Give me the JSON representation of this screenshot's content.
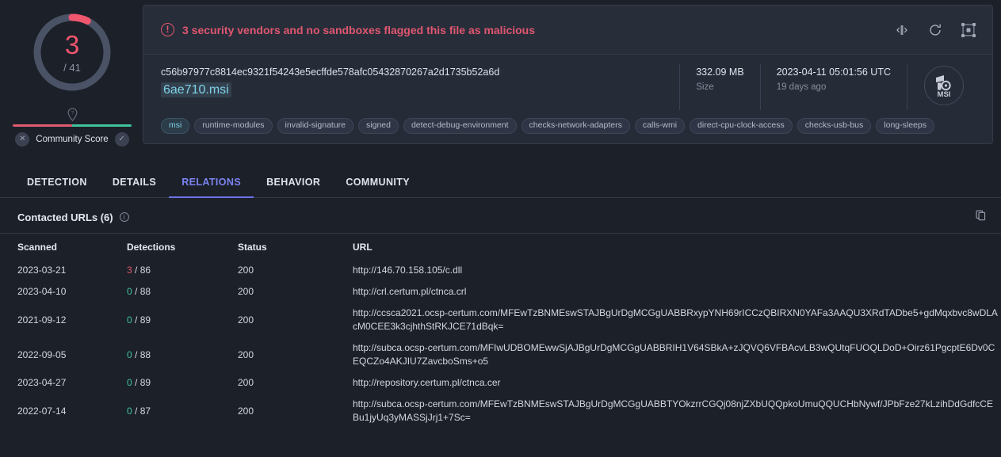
{
  "score": {
    "detections": "3",
    "total": "/ 41",
    "ring_color": "#f0566e",
    "community_label": "Community Score",
    "negative_icon": "x-circle-icon",
    "positive_icon": "check-circle-icon",
    "pin_icon": "help-pin-icon"
  },
  "alert": {
    "text": "3 security vendors and no sandboxes flagged this file as malicious",
    "color": "#e0576f",
    "icon": "exclamation-circle-icon"
  },
  "header_actions": [
    {
      "name": "similar-files-icon",
      "label": "Similar files"
    },
    {
      "name": "reanalyze-icon",
      "label": "Reanalyze"
    },
    {
      "name": "graph-icon",
      "label": "Graph"
    }
  ],
  "file": {
    "hash": "c56b97977c8814ec9321f54243e5ecffde578afc05432870267a2d1735b52a6d",
    "filename": "6ae710.msi",
    "size_value": "332.09 MB",
    "size_label": "Size",
    "date_value": "2023-04-11 05:01:56 UTC",
    "date_label": "19 days ago",
    "type_label": "MSI",
    "type_icon": "msi-installer-icon"
  },
  "tags": [
    {
      "label": "msi",
      "primary": true
    },
    {
      "label": "runtime-modules",
      "primary": false
    },
    {
      "label": "invalid-signature",
      "primary": false
    },
    {
      "label": "signed",
      "primary": false
    },
    {
      "label": "detect-debug-environment",
      "primary": false
    },
    {
      "label": "checks-network-adapters",
      "primary": false
    },
    {
      "label": "calls-wmi",
      "primary": false
    },
    {
      "label": "direct-cpu-clock-access",
      "primary": false
    },
    {
      "label": "checks-usb-bus",
      "primary": false
    },
    {
      "label": "long-sleeps",
      "primary": false
    }
  ],
  "tabs": [
    {
      "label": "DETECTION",
      "active": false
    },
    {
      "label": "DETAILS",
      "active": false
    },
    {
      "label": "RELATIONS",
      "active": true
    },
    {
      "label": "BEHAVIOR",
      "active": false
    },
    {
      "label": "COMMUNITY",
      "active": false
    }
  ],
  "section": {
    "title": "Contacted URLs (6)",
    "info_icon": "info-icon",
    "copy_icon": "copy-icon"
  },
  "table": {
    "columns": [
      "Scanned",
      "Detections",
      "Status",
      "URL"
    ],
    "rows": [
      {
        "scanned": "2023-03-21",
        "det_count": "3",
        "det_total": "/ 86",
        "det_bad": true,
        "status": "200",
        "url": "http://146.70.158.105/c.dll"
      },
      {
        "scanned": "2023-04-10",
        "det_count": "0",
        "det_total": "/ 88",
        "det_bad": false,
        "status": "200",
        "url": "http://crl.certum.pl/ctnca.crl"
      },
      {
        "scanned": "2021-09-12",
        "det_count": "0",
        "det_total": "/ 89",
        "det_bad": false,
        "status": "200",
        "url": "http://ccsca2021.ocsp-certum.com/MFEwTzBNMEswSTAJBgUrDgMCGgUABBRxypYNH69rICCzQBIRXN0YAFa3AAQU3XRdTADbe5+gdMqxbvc8wDLAcM0CEE3k3cjhthStRKJCE71dBqk="
      },
      {
        "scanned": "2022-09-05",
        "det_count": "0",
        "det_total": "/ 88",
        "det_bad": false,
        "status": "200",
        "url": "http://subca.ocsp-certum.com/MFIwUDBOMEwwSjAJBgUrDgMCGgUABBRIH1V64SBkA+zJQVQ6VFBAcvLB3wQUtqFUOQLDoD+Oirz61PgcptE6Dv0CEQCZo4AKJIU7ZavcboSms+o5"
      },
      {
        "scanned": "2023-04-27",
        "det_count": "0",
        "det_total": "/ 89",
        "det_bad": false,
        "status": "200",
        "url": "http://repository.certum.pl/ctnca.cer"
      },
      {
        "scanned": "2022-07-14",
        "det_count": "0",
        "det_total": "/ 87",
        "det_bad": false,
        "status": "200",
        "url": "http://subca.ocsp-certum.com/MFEwTzBNMEswSTAJBgUrDgMCGgUABBTYOkzrrCGQj08njZXbUQQpkoUmuQQUCHbNywf/JPbFze27kLzihDdGdfcCEBu1jyUq3yMASSjJrj1+7Sc="
      }
    ]
  }
}
